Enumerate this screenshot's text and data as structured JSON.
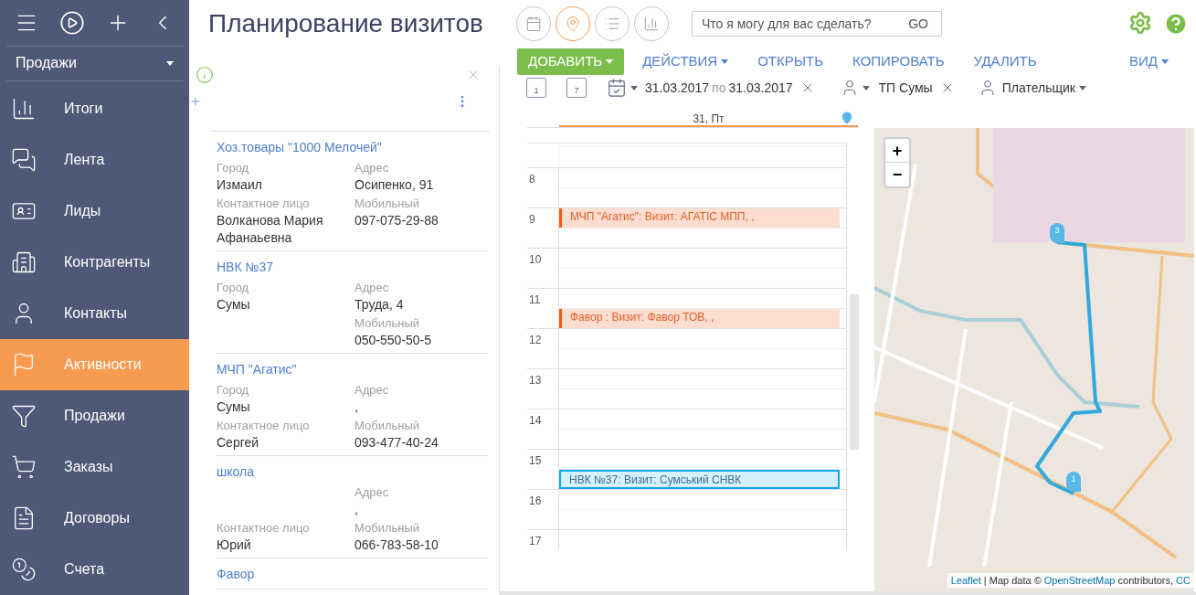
{
  "sidebar": {
    "workplace": "Продажи",
    "items": [
      {
        "label": "Итоги",
        "selected": false
      },
      {
        "label": "Лента",
        "selected": false
      },
      {
        "label": "Лиды",
        "selected": false
      },
      {
        "label": "Контрагенты",
        "selected": false
      },
      {
        "label": "Контакты",
        "selected": false
      },
      {
        "label": "Активности",
        "selected": true
      },
      {
        "label": "Продажи",
        "selected": false
      },
      {
        "label": "Заказы",
        "selected": false
      },
      {
        "label": "Договоры",
        "selected": false
      },
      {
        "label": "Счета",
        "selected": false
      }
    ]
  },
  "header": {
    "title": "Планирование визитов",
    "views": [
      {
        "selected": false
      },
      {
        "selected": true
      },
      {
        "selected": false
      },
      {
        "selected": false
      }
    ],
    "search": {
      "placeholder": "Что я могу для вас сделать?",
      "button": "GO"
    }
  },
  "accounts": [
    {
      "title": "Хоз.товары \"1000 Мелочей\"",
      "rows": [
        {
          "left": {
            "label": "Город",
            "value": "Измаил"
          },
          "right": {
            "label": "Адрес",
            "value": "Осипенко, 91"
          }
        },
        {
          "left": {
            "label": "Контактное лицо",
            "value": "Волканова Мария Афанаьевна"
          },
          "right": {
            "label": "Мобильный",
            "value": "097-075-29-88"
          }
        }
      ]
    },
    {
      "title": "НВК №37",
      "rows": [
        {
          "left": {
            "label": "Город",
            "value": "Сумы"
          },
          "right": {
            "label": "Адрес",
            "value": "Труда, 4"
          }
        },
        {
          "right": {
            "label": "Мобильный",
            "value": "050-550-50-5"
          }
        }
      ]
    },
    {
      "title": "МЧП \"Агатис\"",
      "rows": [
        {
          "left": {
            "label": "Город",
            "value": "Сумы"
          },
          "right": {
            "label": "Адрес",
            "value": ","
          }
        },
        {
          "left": {
            "label": "Контактное лицо",
            "value": "Сергей"
          },
          "right": {
            "label": "Мобильный",
            "value": "093-477-40-24"
          }
        }
      ]
    },
    {
      "title": "школа",
      "rows": [
        {
          "right": {
            "label": "Адрес",
            "value": ","
          }
        },
        {
          "left": {
            "label": "Контактное лицо",
            "value": "Юрий"
          },
          "right": {
            "label": "Мобильный",
            "value": "066-783-58-10"
          }
        }
      ]
    },
    {
      "title": "Фавор"
    }
  ],
  "toolbar": {
    "add": "ДОБАВИТЬ",
    "actions": "ДЕЙСТВИЯ",
    "links": [
      "ОТКРЫТЬ",
      "КОПИРОВАТЬ",
      "УДАЛИТЬ"
    ],
    "view": "ВИД"
  },
  "filters": {
    "period_buttons": [
      "1",
      "7"
    ],
    "date_from": "31.03.2017",
    "date_sep": "по",
    "date_to": "31.03.2017",
    "owner": "ТП Сумы",
    "payer": "Плательщик"
  },
  "calendar": {
    "day": "31, Пт",
    "hours": [
      {
        "label": "8"
      },
      {
        "label": "9",
        "events": [
          {
            "kind": "on_hour",
            "text": "МЧП \"Агатис\": Визит: АГАТІС МПП, ,",
            "selected": false
          }
        ]
      },
      {
        "label": "10"
      },
      {
        "label": "11",
        "events": [
          {
            "kind": "half_past",
            "text": "Фавор : Визит: Фавор ТОВ, ,",
            "selected": false
          }
        ]
      },
      {
        "label": "12"
      },
      {
        "label": "13"
      },
      {
        "label": "14"
      },
      {
        "label": "15",
        "events": [
          {
            "kind": "half_past",
            "text": "НВК №37: Визит: Сумський СНВК",
            "selected": true
          }
        ]
      },
      {
        "label": "16"
      },
      {
        "label": "17"
      }
    ]
  },
  "map": {
    "zoom_in": "+",
    "zoom_out": "−",
    "markers": [
      "3",
      "1"
    ],
    "attribution": [
      {
        "text": "Leaflet",
        "link": true
      },
      {
        "text": " | Map data © ",
        "link": false
      },
      {
        "text": "OpenStreetMap",
        "link": true
      },
      {
        "text": " contributors, ",
        "link": false
      },
      {
        "text": "CC",
        "link": true
      }
    ]
  }
}
